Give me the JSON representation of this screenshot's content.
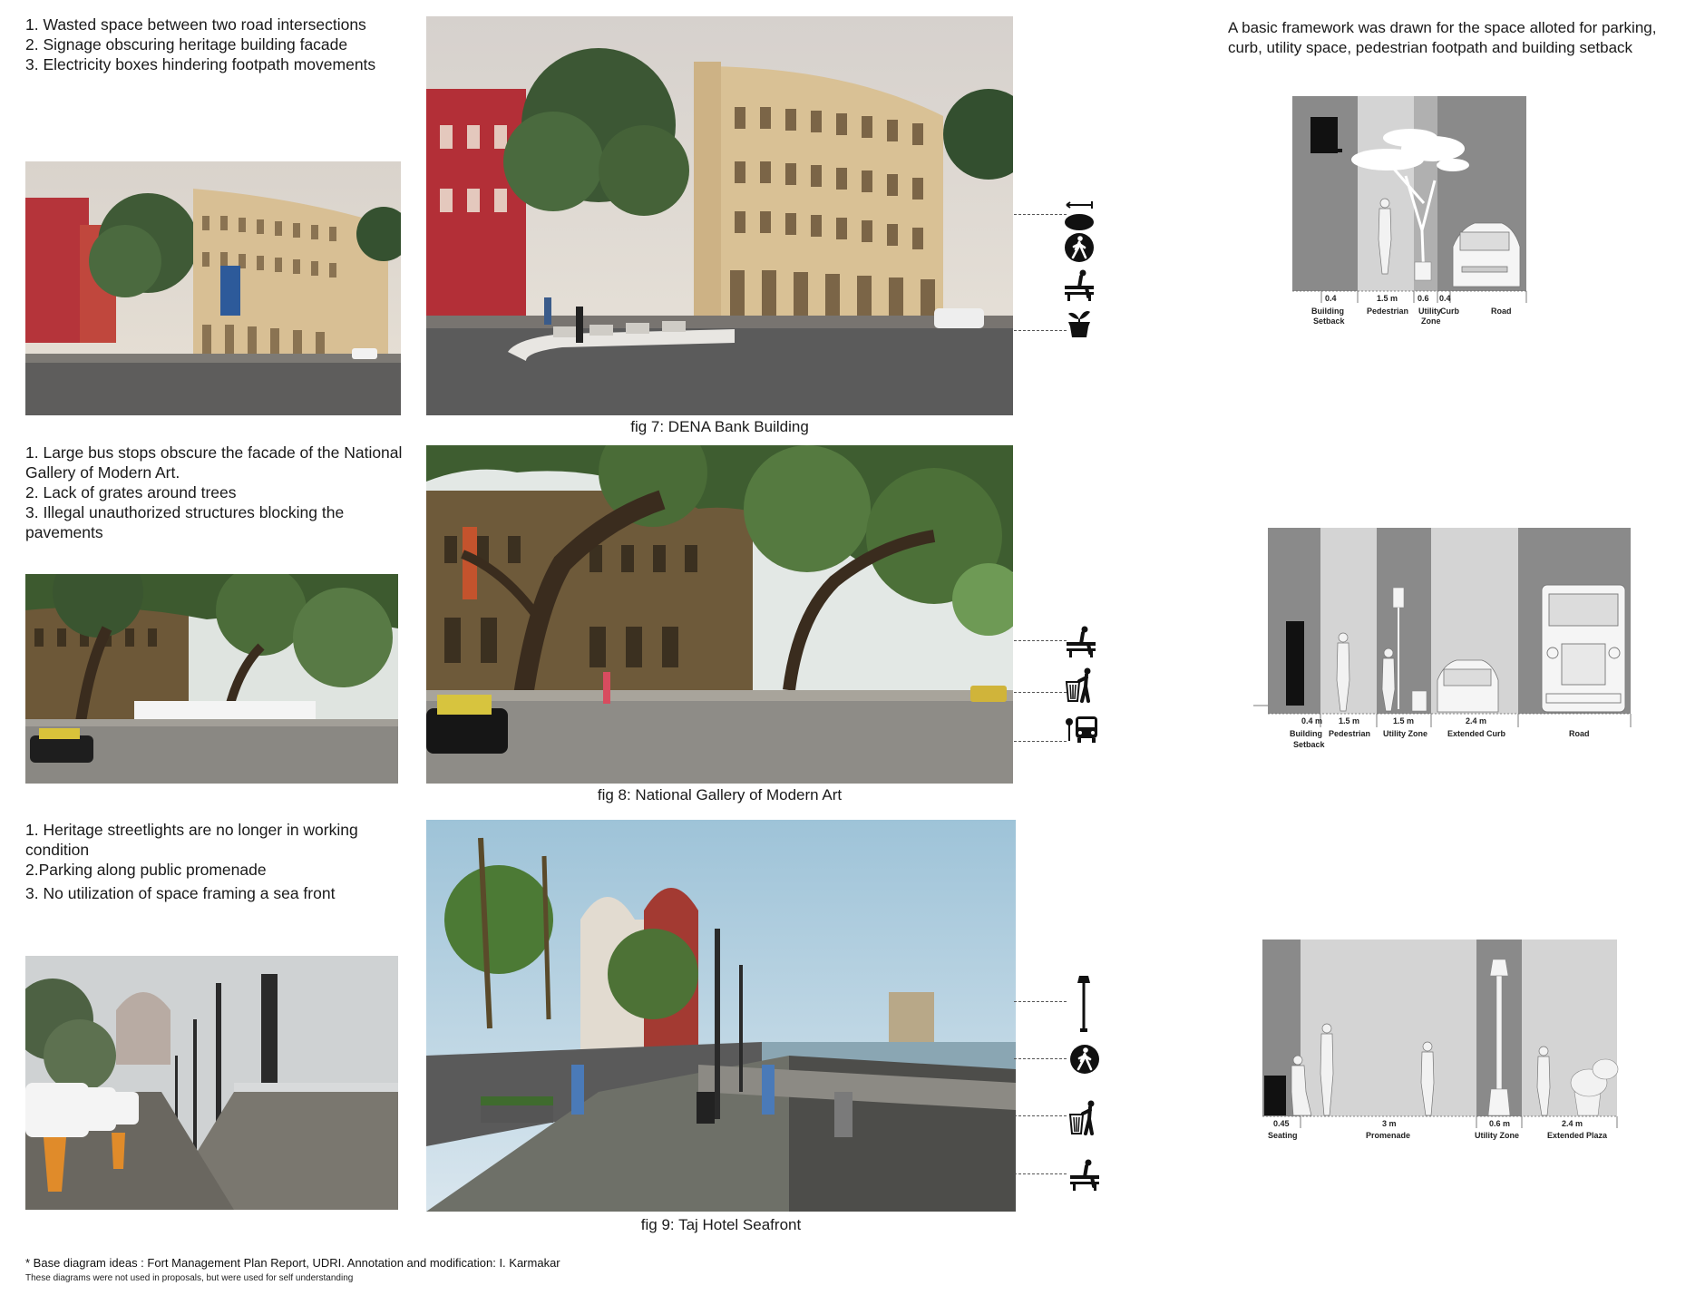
{
  "sections": [
    {
      "notes": [
        "1. Wasted space between two road intersections",
        "2. Signage obscuring heritage building facade",
        "3. Electricity boxes hindering footpath movements"
      ],
      "caption": "fig 7: DENA Bank Building"
    },
    {
      "notes": [
        "1. Large bus stops obscure the facade of the National",
        "Gallery of Modern Art.",
        "2. Lack of grates around trees",
        "3. Illegal unauthorized structures blocking the",
        "pavements"
      ],
      "caption": "fig 8: National Gallery of Modern Art"
    },
    {
      "notes": [
        "1. Heritage streetlights are no longer in working",
        "condition",
        "2.Parking along public promenade",
        "3. No utilization of space  framing a sea front"
      ],
      "caption": "fig 9: Taj Hotel Seafront"
    }
  ],
  "framework_text": [
    "A basic framework was drawn for the space alloted for parking,",
    "curb, utility space, pedestrian footpath and building setback"
  ],
  "diagram1": {
    "dims": [
      "0.4",
      "1.5 m",
      "0.6",
      "0.4"
    ],
    "labels": [
      "Building",
      "Setback",
      "Pedestrian",
      "Utility",
      "Zone",
      "Curb",
      "Road"
    ]
  },
  "diagram2": {
    "dims": [
      "0.4 m",
      "1.5 m",
      "1.5 m",
      "2.4 m"
    ],
    "labels": [
      "Building",
      "Setback",
      "Pedestrian",
      "Utility Zone",
      "Extended Curb",
      "Road"
    ]
  },
  "diagram3": {
    "dims": [
      "0.45",
      "3 m",
      "0.6 m",
      "2.4 m"
    ],
    "labels": [
      "Seating",
      "Promenade",
      "Utility Zone",
      "Extended Plaza"
    ]
  },
  "footer": {
    "line1": "* Base diagram ideas : Fort Management Plan Report, UDRI. Annotation and modification: I. Karmakar",
    "line2": "These diagrams were not used in proposals, but were used for self understanding"
  },
  "icons": {
    "section1": [
      "signage-icon",
      "pedestrian-crossing-icon",
      "bench-icon",
      "planter-icon"
    ],
    "section2": [
      "bench-icon",
      "dustbin-icon",
      "bus-stop-icon"
    ],
    "section3": [
      "streetlight-icon",
      "pedestrian-crossing-icon",
      "dustbin-icon",
      "bench-icon"
    ]
  },
  "colors": {
    "dark_zone": "#8a8a8a",
    "light_zone": "#d4d4d4",
    "mid_zone": "#b0b0b0"
  }
}
